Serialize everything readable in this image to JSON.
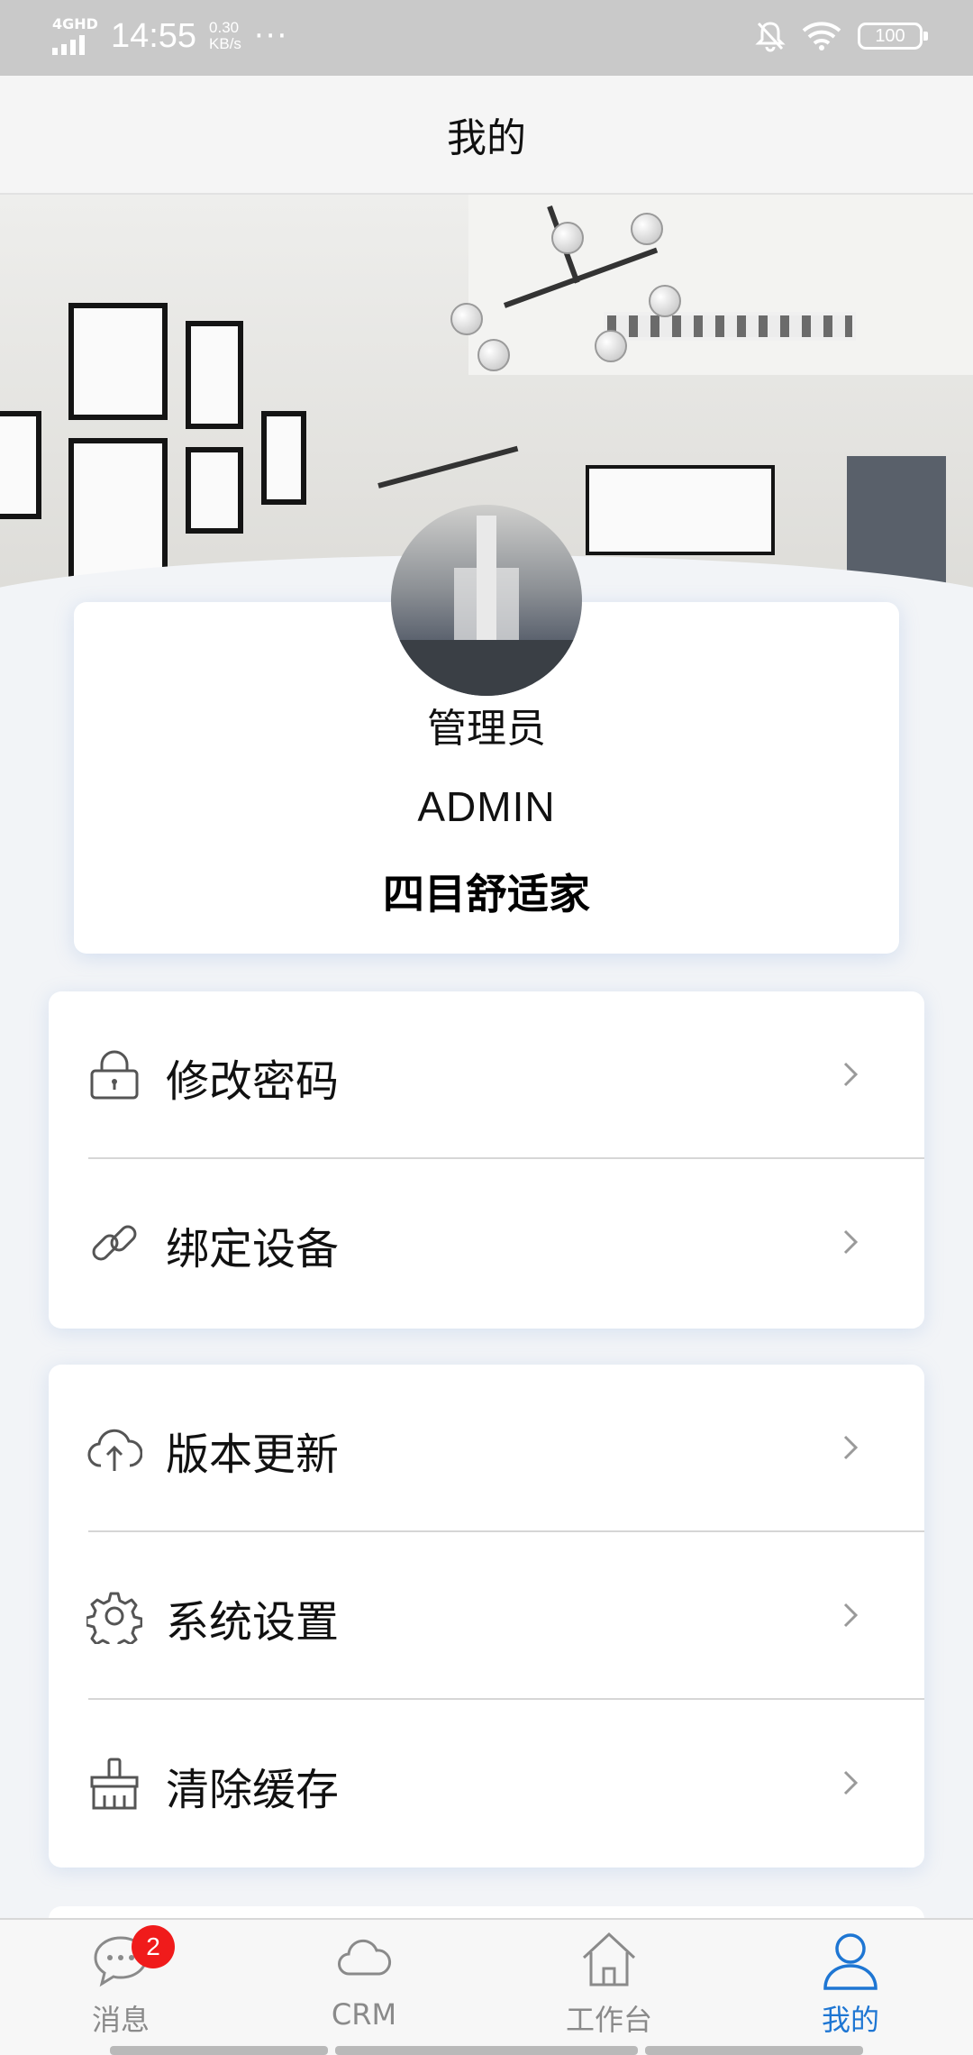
{
  "status_bar": {
    "network": "4GHD",
    "time": "14:55",
    "net_speed_value": "0.30",
    "net_speed_unit": "KB/s",
    "more": "···",
    "battery": "100"
  },
  "header": {
    "title": "我的"
  },
  "profile": {
    "name": "管理员",
    "username": "ADMIN",
    "organization": "四目舒适家"
  },
  "menu_group_1": {
    "items": [
      {
        "label": "修改密码",
        "icon": "lock-icon"
      },
      {
        "label": "绑定设备",
        "icon": "link-icon"
      }
    ]
  },
  "menu_group_2": {
    "items": [
      {
        "label": "版本更新",
        "icon": "cloud-upload-icon"
      },
      {
        "label": "系统设置",
        "icon": "gear-icon"
      },
      {
        "label": "清除缓存",
        "icon": "broom-icon"
      }
    ]
  },
  "tab_bar": {
    "tabs": [
      {
        "label": "消息",
        "icon": "chat-bubble-icon",
        "badge": "2",
        "active": false
      },
      {
        "label": "CRM",
        "icon": "cloud-icon",
        "active": false
      },
      {
        "label": "工作台",
        "icon": "home-icon",
        "active": false
      },
      {
        "label": "我的",
        "icon": "user-icon",
        "active": true
      }
    ]
  },
  "colors": {
    "accent": "#1e76d3",
    "badge": "#f01b1b",
    "status_bar": "#c9c9c9",
    "inactive_tab": "#8a8a8a"
  }
}
